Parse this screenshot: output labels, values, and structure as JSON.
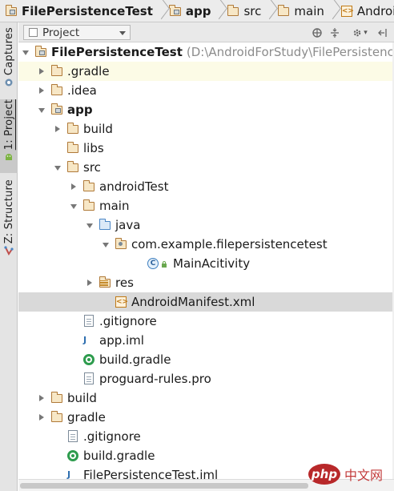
{
  "breadcrumb": [
    {
      "label": "FilePersistenceTest",
      "bold": true,
      "icon": "project-folder-icon"
    },
    {
      "label": "app",
      "bold": true,
      "icon": "module-folder-icon"
    },
    {
      "label": "src",
      "bold": false,
      "icon": "folder-icon"
    },
    {
      "label": "main",
      "bold": false,
      "icon": "folder-icon"
    },
    {
      "label": "AndroidManifest.xml",
      "bold": false,
      "icon": "xml-file-icon"
    }
  ],
  "tool_tabs": [
    {
      "label": "Captures",
      "icon": "captures-icon"
    },
    {
      "label": "1: Project",
      "icon": "android-icon",
      "active": true
    },
    {
      "label": "Z: Structure",
      "icon": "structure-icon"
    }
  ],
  "panel": {
    "view_selector": "Project",
    "icons": [
      "sync-icon",
      "collapse-all-icon",
      "gear-icon",
      "hide-panel-icon"
    ]
  },
  "tree": {
    "rows": [
      {
        "label": "FilePersistenceTest",
        "path": "(D:\\AndroidForStudy\\FilePersistence",
        "bold": true,
        "expand": "down",
        "icon": "module",
        "depth": 0,
        "highlight": false
      },
      {
        "label": ".gradle",
        "expand": "right",
        "icon": "folder",
        "depth": 1,
        "highlight": true
      },
      {
        "label": ".idea",
        "expand": "right",
        "icon": "folder",
        "depth": 1
      },
      {
        "label": "app",
        "bold": true,
        "expand": "down",
        "icon": "module",
        "depth": 1
      },
      {
        "label": "build",
        "expand": "right",
        "icon": "folder",
        "depth": 2
      },
      {
        "label": "libs",
        "expand": "none",
        "icon": "folder",
        "depth": 2
      },
      {
        "label": "src",
        "expand": "down",
        "icon": "folder",
        "depth": 2
      },
      {
        "label": "androidTest",
        "expand": "right",
        "icon": "folder",
        "depth": 3
      },
      {
        "label": "main",
        "expand": "down",
        "icon": "folder",
        "depth": 3
      },
      {
        "label": "java",
        "expand": "down",
        "icon": "source-folder",
        "depth": 4
      },
      {
        "label": "com.example.filepersistencetest",
        "expand": "down",
        "icon": "package",
        "depth": 5
      },
      {
        "label": "MainAcitivity",
        "expand": "none",
        "icon": "class",
        "depth": 7
      },
      {
        "label": "res",
        "expand": "right",
        "icon": "res-folder",
        "depth": 4
      },
      {
        "label": "AndroidManifest.xml",
        "expand": "none",
        "icon": "xml",
        "depth": 5,
        "selected": true
      },
      {
        "label": ".gitignore",
        "expand": "none",
        "icon": "text-file",
        "depth": 3
      },
      {
        "label": "app.iml",
        "expand": "none",
        "icon": "iml",
        "depth": 3
      },
      {
        "label": "build.gradle",
        "expand": "none",
        "icon": "gradle",
        "depth": 3
      },
      {
        "label": "proguard-rules.pro",
        "expand": "none",
        "icon": "text-file",
        "depth": 3
      },
      {
        "label": "build",
        "expand": "right",
        "icon": "folder",
        "depth": 1
      },
      {
        "label": "gradle",
        "expand": "right",
        "icon": "folder",
        "depth": 1
      },
      {
        "label": ".gitignore",
        "expand": "none",
        "icon": "text-file",
        "depth": 2
      },
      {
        "label": "build.gradle",
        "expand": "none",
        "icon": "gradle",
        "depth": 2
      },
      {
        "label": "FilePersistenceTest.iml",
        "expand": "none",
        "icon": "iml",
        "depth": 2
      }
    ]
  },
  "watermark": {
    "badge": "php",
    "text": "中文网"
  },
  "colors": {
    "folder": "#b07a39",
    "source_folder": "#4a86c5",
    "selection": "#d9d9d9",
    "highlight": "#fcfbe6"
  }
}
